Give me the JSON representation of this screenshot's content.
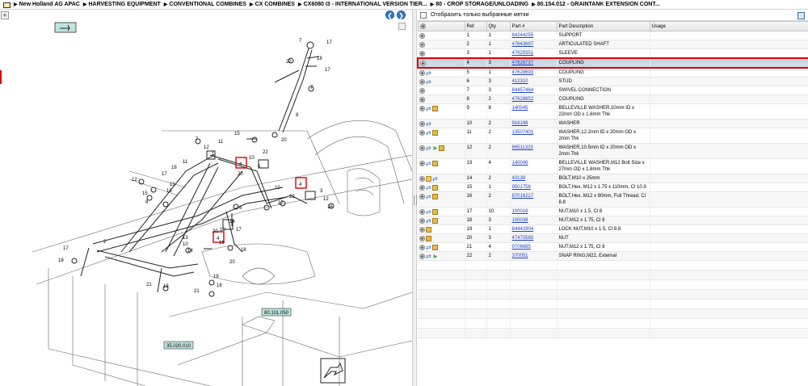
{
  "breadcrumb": [
    "New Holland AG APAC",
    "HARVESTING EQUIPMENT",
    "CONVENTIONAL COMBINES",
    "CX COMBINES",
    "CX6080 I3 - INTERNATIONAL VERSION TIER...",
    "80 - CROP STORAGE/UNLOADING",
    "80.154.012 - GRAINTANK EXTENSION CONT..."
  ],
  "diagram": {
    "refs": {
      "r1": "1",
      "r2": "2",
      "r3": "3",
      "r4": "4",
      "r5": "5",
      "r6": "6",
      "r7": "7",
      "r8": "8",
      "r9": "9",
      "r10": "10",
      "r11": "11",
      "r12": "12",
      "r13": "13",
      "r14": "14",
      "r15": "15",
      "r16": "16",
      "r17": "17",
      "r18": "18",
      "r19": "19",
      "r20": "20",
      "r21": "21",
      "r22": "22"
    },
    "callout_a": "80.101.050",
    "callout_b": "35.020.010"
  },
  "filter": {
    "label": "Отобразить только выбранные метки"
  },
  "table": {
    "headers": {
      "ref": "Ref",
      "qty": "Qty",
      "part": "Part #",
      "desc": "Part Description",
      "usage": "Usage"
    },
    "rows": [
      {
        "ref": "1",
        "qty": "1",
        "part": "84244255",
        "desc": "SUPPORT",
        "icons": [
          "add"
        ]
      },
      {
        "ref": "2",
        "qty": "1",
        "part": "47643697",
        "desc": "ARTICULATED SHAFT",
        "icons": [
          "add"
        ]
      },
      {
        "ref": "3",
        "qty": "1",
        "part": "47629351",
        "desc": "SLEEVE",
        "icons": [
          "add"
        ]
      },
      {
        "ref": "4",
        "qty": "3",
        "part": "47628737",
        "desc": "COUPLING",
        "icons": [
          "add"
        ],
        "selected": true
      },
      {
        "ref": "5",
        "qty": "1",
        "part": "47628693",
        "desc": "COUPLING",
        "icons": [
          "add",
          "swap"
        ]
      },
      {
        "ref": "6",
        "qty": "3",
        "part": "412310",
        "desc": "STUD",
        "icons": [
          "add",
          "swap"
        ]
      },
      {
        "ref": "7",
        "qty": "3",
        "part": "84457464",
        "desc": "SWIVEL CONNECTION",
        "icons": [
          "add"
        ]
      },
      {
        "ref": "8",
        "qty": "2",
        "part": "47628652",
        "desc": "COUPLING",
        "icons": [
          "add"
        ]
      },
      {
        "ref": "9",
        "qty": "8",
        "part": "140045",
        "desc": "BELLEVILLE WASHER,10mm ID x 22mm OD x 1.6mm Thk",
        "icons": [
          "add",
          "swap",
          "box"
        ]
      },
      {
        "ref": "10",
        "qty": "2",
        "part": "916196",
        "desc": "WASHER",
        "icons": [
          "add",
          "swap"
        ]
      },
      {
        "ref": "11",
        "qty": "2",
        "part": "13507401",
        "desc": "WASHER,12.2mm ID x 20mm OD x 2mm Thk",
        "icons": [
          "add",
          "swap",
          "box"
        ]
      },
      {
        "ref": "12",
        "qty": "2",
        "part": "86511323",
        "desc": "WASHER,10.5mm ID x 20mm OD x 2mm Thk",
        "icons": [
          "add",
          "swap",
          "green",
          "box"
        ]
      },
      {
        "ref": "13",
        "qty": "4",
        "part": "140046",
        "desc": "BELLEVILLE WASHER,M12 Bolt Size x 27mm OD x 1.8mm Thk",
        "icons": [
          "add",
          "swap",
          "box"
        ]
      },
      {
        "ref": "14",
        "qty": "2",
        "part": "43139",
        "desc": "BOLT,M10 x 25mm",
        "icons": [
          "add",
          "note",
          "swap"
        ]
      },
      {
        "ref": "15",
        "qty": "1",
        "part": "9501756",
        "desc": "BOLT,Hex, M12 x 1.75 x 110mm, Cl 10.9",
        "icons": [
          "add",
          "swap",
          "box"
        ]
      },
      {
        "ref": "16",
        "qty": "2",
        "part": "87016227",
        "desc": "BOLT,Hex, M12 x 80mm, Full Thread, Cl 8.8",
        "icons": [
          "add",
          "swap",
          "box"
        ]
      },
      {
        "ref": "17",
        "qty": "10",
        "part": "100016",
        "desc": "NUT,M10 x 1.5, Cl 8",
        "icons": [
          "add",
          "swap",
          "box"
        ]
      },
      {
        "ref": "18",
        "qty": "3",
        "part": "100038",
        "desc": "NUT,M12 x 1.75, Cl 8",
        "icons": [
          "add",
          "swap",
          "box"
        ]
      },
      {
        "ref": "19",
        "qty": "1",
        "part": "84442904",
        "desc": "LOCK NUT,M10 x 1.5, Cl 8.8",
        "icons": [
          "add",
          "box"
        ]
      },
      {
        "ref": "20",
        "qty": "3",
        "part": "47470565",
        "desc": "NUT",
        "icons": [
          "add",
          "box"
        ]
      },
      {
        "ref": "21",
        "qty": "4",
        "part": "9706685",
        "desc": "NUT,M12 x 1.75, Cl 8",
        "icons": [
          "add",
          "swap",
          "box"
        ]
      },
      {
        "ref": "22",
        "qty": "2",
        "part": "370051",
        "desc": "SNAP RING,M22, External",
        "icons": [
          "add",
          "swap",
          "green"
        ]
      }
    ]
  },
  "colors": {
    "selection_border": "#dd0000",
    "link": "#1a3dc4",
    "selected_bg": "#cfd9e6"
  }
}
